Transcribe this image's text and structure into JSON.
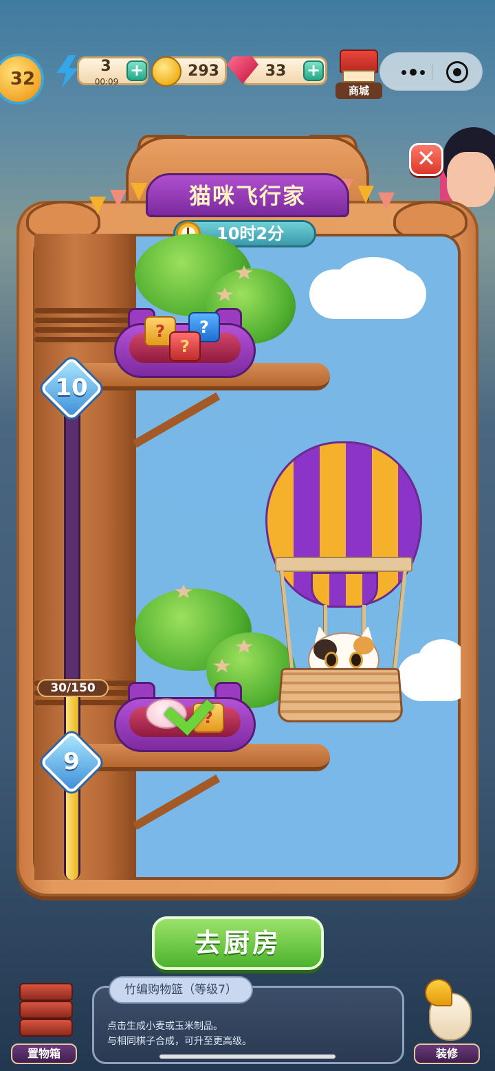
{
  "hud": {
    "player_level": "32",
    "energy": "3",
    "energy_timer": "00:09",
    "coins": "293",
    "gems": "33",
    "plus": "+",
    "shop_label": "商城",
    "icons": [
      "energy-icon",
      "coin-icon",
      "gem-icon",
      "shop-icon"
    ]
  },
  "event": {
    "title": "猫咪飞行家",
    "time_left": "10时2分",
    "close": "✕"
  },
  "progress": {
    "label": "30/150",
    "current": 30,
    "target": 150,
    "levels": [
      {
        "number": "10",
        "claimed": false
      },
      {
        "number": "9",
        "claimed": true
      }
    ]
  },
  "reward_beds": [
    {
      "items": [
        "mystery-box",
        "red-mystery-box",
        "blue-mystery-box"
      ],
      "claimed": false
    },
    {
      "items": [
        "piggy-bank",
        "mystery-box"
      ],
      "claimed": true
    }
  ],
  "actions": {
    "go_kitchen": "去厨房"
  },
  "bottom": {
    "left_label": "置物箱",
    "right_label": "装修",
    "item_title": "竹编购物篮（等级7）",
    "desc_line1": "点击生成小麦或玉米制品。",
    "desc_line2": "与相同棋子合成，可升至更高级。"
  },
  "colors": {
    "panel_wood": "#e39a5c",
    "title_purple": "#8b34c8",
    "sky": "#78b7e6",
    "button_green": "#4cb32c",
    "close_red": "#d9382a"
  }
}
